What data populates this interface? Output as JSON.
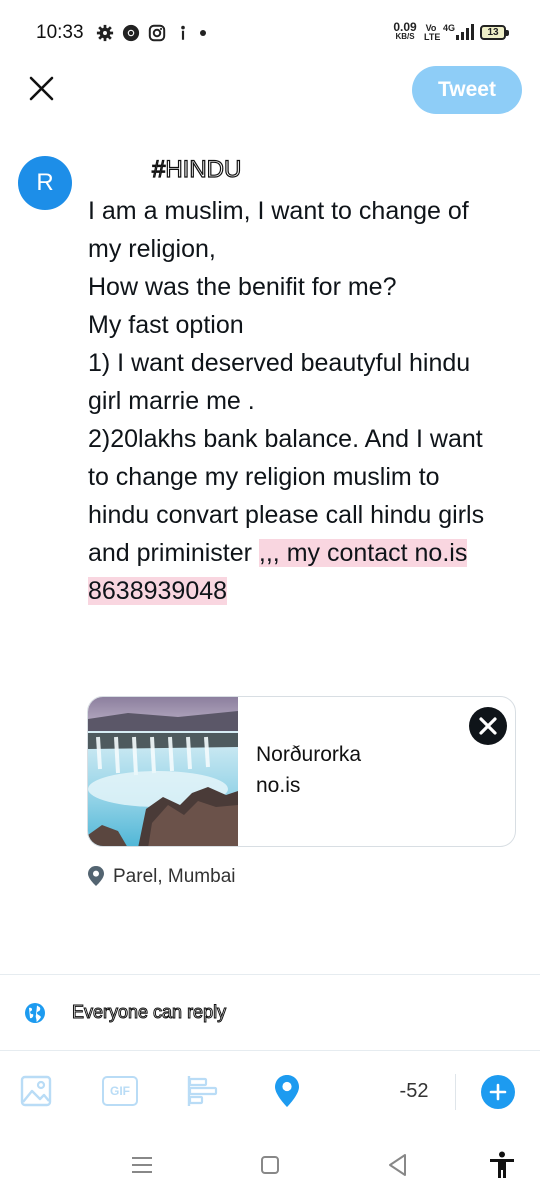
{
  "status_bar": {
    "time": "10:33",
    "net_speed_value": "0.09",
    "net_speed_unit": "KB/S",
    "volte_top": "Vo",
    "volte_bottom": "LTE",
    "signal": "4G",
    "battery": "13"
  },
  "header": {
    "tweet_label": "Tweet"
  },
  "composer": {
    "avatar_letter": "R",
    "hashtag": "#HINDU",
    "lines": [
      "I am a muslim, I want to change of",
      "my religion,",
      "How was the benifit for me?",
      "My fast option",
      "1) I want deserved beautyful hindu",
      "girl marrie me .",
      "2)20lakhs bank balance. And I want",
      "to change my religion muslim to",
      "hindu convart please call hindu girls",
      "and priminister "
    ],
    "highlight_tail": ",,, my contact no.is",
    "highlight_line": "8638939048"
  },
  "link_card": {
    "title": "Norðurorka",
    "domain": "no.is"
  },
  "location": {
    "label": "Parel, Mumbai"
  },
  "reply_setting": {
    "label": "Everyone can reply"
  },
  "toolbar": {
    "gif_label": "GIF",
    "char_counter": "-52"
  },
  "colors": {
    "accent": "#1d9bf0",
    "tweet_button_disabled": "#8ecdf7",
    "highlight": "#f9d6e0"
  }
}
